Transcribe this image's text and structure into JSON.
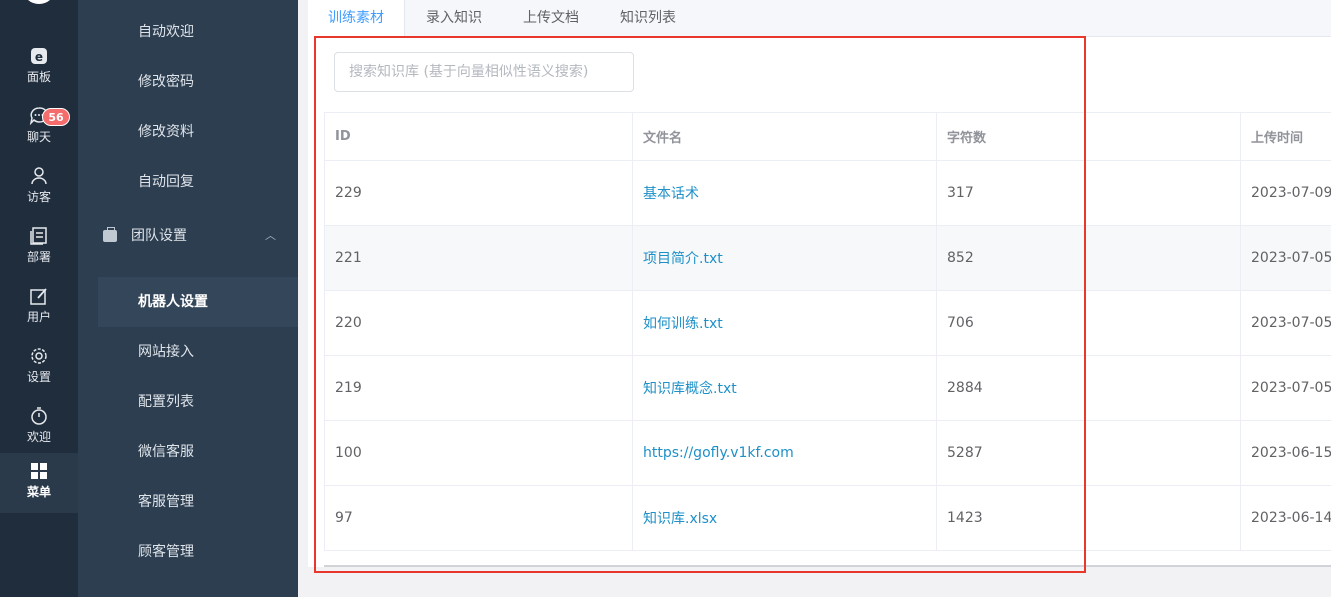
{
  "rail": {
    "items": [
      {
        "label": "面板",
        "icon": "dashboard-icon"
      },
      {
        "label": "聊天",
        "icon": "chat-icon",
        "badge": "56"
      },
      {
        "label": "访客",
        "icon": "visitor-icon"
      },
      {
        "label": "部署",
        "icon": "deploy-icon"
      },
      {
        "label": "用户",
        "icon": "user-edit-icon"
      },
      {
        "label": "设置",
        "icon": "gear-icon"
      },
      {
        "label": "欢迎",
        "icon": "timer-icon"
      },
      {
        "label": "菜单",
        "icon": "grid-icon"
      }
    ]
  },
  "submenu": {
    "top_items": [
      "自动欢迎",
      "修改密码",
      "修改资料",
      "自动回复"
    ],
    "group": "团队设置",
    "group_items": [
      "机器人设置",
      "网站接入",
      "配置列表",
      "微信客服",
      "客服管理",
      "顾客管理"
    ]
  },
  "tabs": [
    "训练素材",
    "录入知识",
    "上传文档",
    "知识列表"
  ],
  "search": {
    "placeholder": "搜索知识库 (基于向量相似性语义搜索)"
  },
  "table": {
    "headers": [
      "ID",
      "文件名",
      "字符数",
      "上传时间"
    ],
    "rows": [
      {
        "id": "229",
        "name": "基本话术",
        "chars": "317",
        "time": "2023-07-09"
      },
      {
        "id": "221",
        "name": "项目简介.txt",
        "chars": "852",
        "time": "2023-07-05"
      },
      {
        "id": "220",
        "name": "如何训练.txt",
        "chars": "706",
        "time": "2023-07-05"
      },
      {
        "id": "219",
        "name": "知识库概念.txt",
        "chars": "2884",
        "time": "2023-07-05"
      },
      {
        "id": "100",
        "name": "https://gofly.v1kf.com",
        "chars": "5287",
        "time": "2023-06-15"
      },
      {
        "id": "97",
        "name": "知识库.xlsx",
        "chars": "1423",
        "time": "2023-06-14"
      }
    ]
  },
  "colors": {
    "accent": "#409eff",
    "link": "#1e90c8",
    "highlight": "#e8372b",
    "rail_bg": "#1f2d3d",
    "submenu_bg": "#2c3e50"
  }
}
